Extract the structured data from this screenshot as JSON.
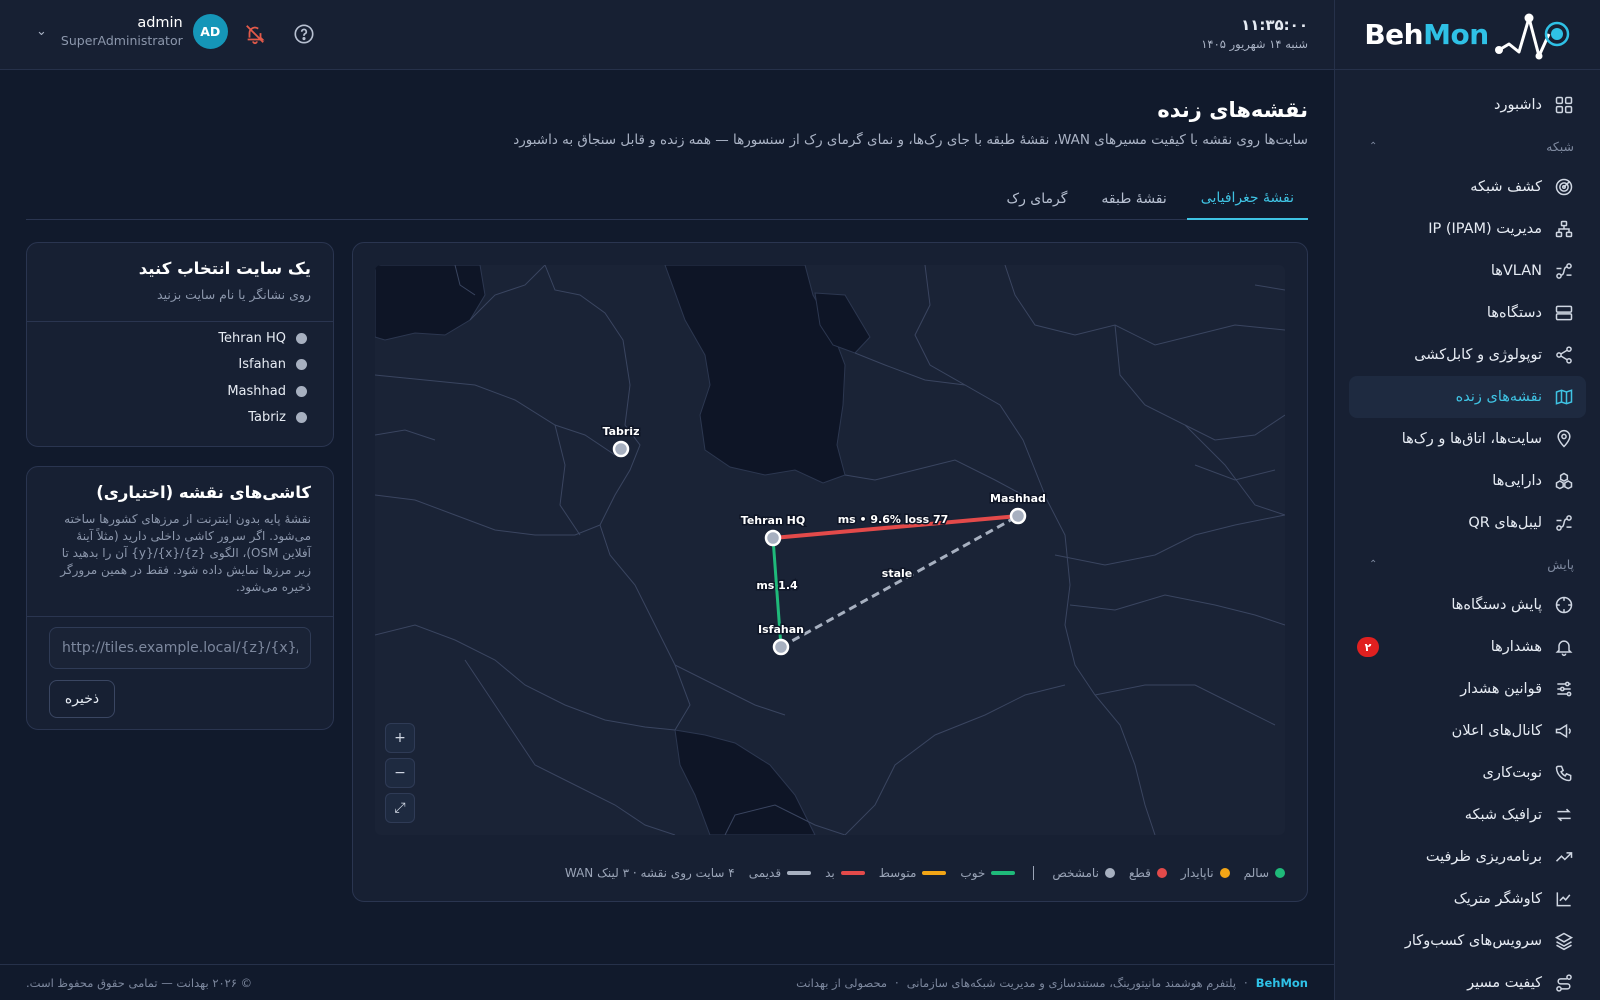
{
  "brand": {
    "part1": "Beh",
    "part2": "Mon"
  },
  "topbar": {
    "time": "۱۱:۳۵:۰۰",
    "date": "شنبه ۱۴ شهریور ۱۴۰۵",
    "user_name": "admin",
    "user_role": "SuperAdministrator",
    "avatar_initials": "AD"
  },
  "sidebar": {
    "items": [
      {
        "label": "داشبورد",
        "icon": "dashboard-icon"
      },
      {
        "section": "شبکه"
      },
      {
        "label": "کشف شبکه",
        "icon": "radar-icon"
      },
      {
        "label": "مدیریت IP (IPAM)",
        "icon": "hierarchy-icon"
      },
      {
        "label": "VLANها",
        "icon": "vlan-icon"
      },
      {
        "label": "دستگاه‌ها",
        "icon": "server-icon"
      },
      {
        "label": "توپولوژی و کابل‌کشی",
        "icon": "share-icon"
      },
      {
        "label": "نقشه‌های زنده",
        "icon": "map-icon",
        "active": true
      },
      {
        "label": "سایت‌ها، اتاق‌ها و رک‌ها",
        "icon": "pin-icon"
      },
      {
        "label": "دارایی‌ها",
        "icon": "boxes-icon"
      },
      {
        "label": "لیبل‌های QR",
        "icon": "qr-icon"
      },
      {
        "section": "پایش"
      },
      {
        "label": "پایش دستگاه‌ها",
        "icon": "crosshair-icon"
      },
      {
        "label": "هشدارها",
        "icon": "bell-icon",
        "badge": "۲"
      },
      {
        "label": "قوانین هشدار",
        "icon": "sliders-icon"
      },
      {
        "label": "کانال‌های اعلان",
        "icon": "megaphone-icon"
      },
      {
        "label": "نوبت‌کاری",
        "icon": "phone-icon"
      },
      {
        "label": "ترافیک شبکه",
        "icon": "arrows-icon"
      },
      {
        "label": "برنامه‌ریزی ظرفیت",
        "icon": "trend-icon"
      },
      {
        "label": "کاوشگر متریک",
        "icon": "chart-icon"
      },
      {
        "label": "سرویس‌های کسب‌وکار",
        "icon": "layers-icon"
      },
      {
        "label": "کیفیت مسیر",
        "icon": "route-icon"
      }
    ]
  },
  "page": {
    "title": "نقشه‌های زنده",
    "subtitle": "سایت‌ها روی نقشه با کیفیت مسیرهای WAN، نقشهٔ طبقه با جای رک‌ها، و نمای گرمای رک از سنسورها — همه زنده و قابل سنجاق به داشبورد",
    "tabs": [
      "نقشهٔ جغرافیایی",
      "نقشهٔ طبقه",
      "گرمای رک"
    ]
  },
  "map": {
    "labels": {
      "tehran": "Tehran HQ",
      "isfahan": "Isfahan",
      "mashhad": "Mashhad",
      "tabriz": "Tabriz"
    },
    "link_labels": {
      "tm": "ms • 9.6% loss 77",
      "ti": "ms 1.4",
      "im": "stale"
    },
    "zoom_in": "+",
    "zoom_out": "−",
    "fullscreen": "⤢"
  },
  "legend": {
    "healthy": "سالم",
    "unstable": "ناپایدار",
    "down": "قطع",
    "unknown": "نامشخص",
    "good": "خوب",
    "medium": "متوسط",
    "bad": "بد",
    "stale": "قدیمی",
    "summary": "۴ سایت روی نقشه · ۳ لینک WAN",
    "colors": {
      "healthy": "#1fba7a",
      "unstable": "#f2a516",
      "down": "#e34a4a",
      "unknown": "#a7b0c0"
    }
  },
  "site_panel": {
    "title": "یک سایت انتخاب کنید",
    "subtitle": "روی نشانگر یا نام سایت بزنید",
    "sites": [
      "Tehran HQ",
      "Isfahan",
      "Mashhad",
      "Tabriz"
    ]
  },
  "tile_panel": {
    "title": "کاشی‌های نقشه (اختیاری)",
    "description": "نقشهٔ پایه بدون اینترنت از مرزهای کشورها ساخته می‌شود. اگر سرور کاشی داخلی دارید (مثلاً آینهٔ آفلاین OSM)، الگوی {z}/{x}/{y} آن را بدهید تا زیر مرزها نمایش داده شود. فقط در همین مرورگر ذخیره می‌شود.",
    "placeholder": "http://tiles.example.local/{z}/{x}/{y}.png",
    "save": "ذخیره"
  },
  "footer": {
    "brand": "BehMon",
    "text1": "پلتفرم هوشمند مانیتورینگ، مستندسازی و مدیریت شبکه‌های سازمانی",
    "text2": "محصولی از بهدانت",
    "copyright": "© ۲۰۲۶ بهدانت — تمامی حقوق محفوظ است."
  }
}
